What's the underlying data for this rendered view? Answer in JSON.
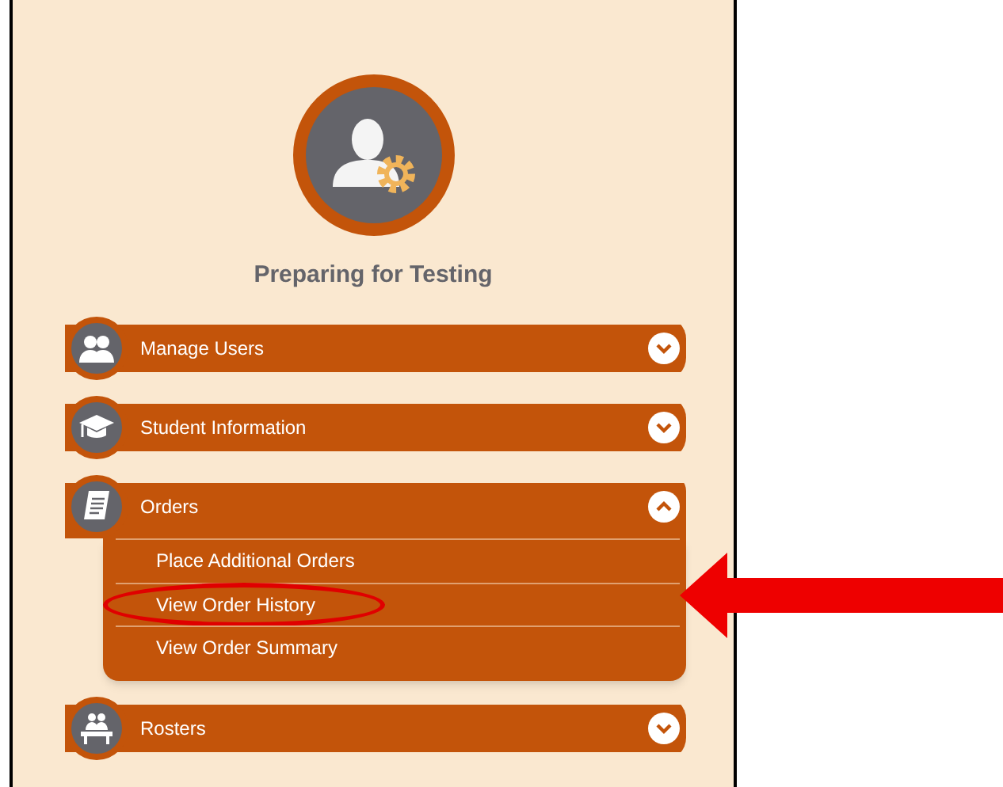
{
  "title": "Preparing for Testing",
  "sections": [
    {
      "label": "Manage Users",
      "expanded": false
    },
    {
      "label": "Student Information",
      "expanded": false
    },
    {
      "label": "Orders",
      "expanded": true,
      "items": [
        {
          "label": "Place Additional Orders",
          "highlighted": false
        },
        {
          "label": "View Order History",
          "highlighted": true
        },
        {
          "label": "View Order Summary",
          "highlighted": false
        }
      ]
    },
    {
      "label": "Rosters",
      "expanded": false
    }
  ]
}
